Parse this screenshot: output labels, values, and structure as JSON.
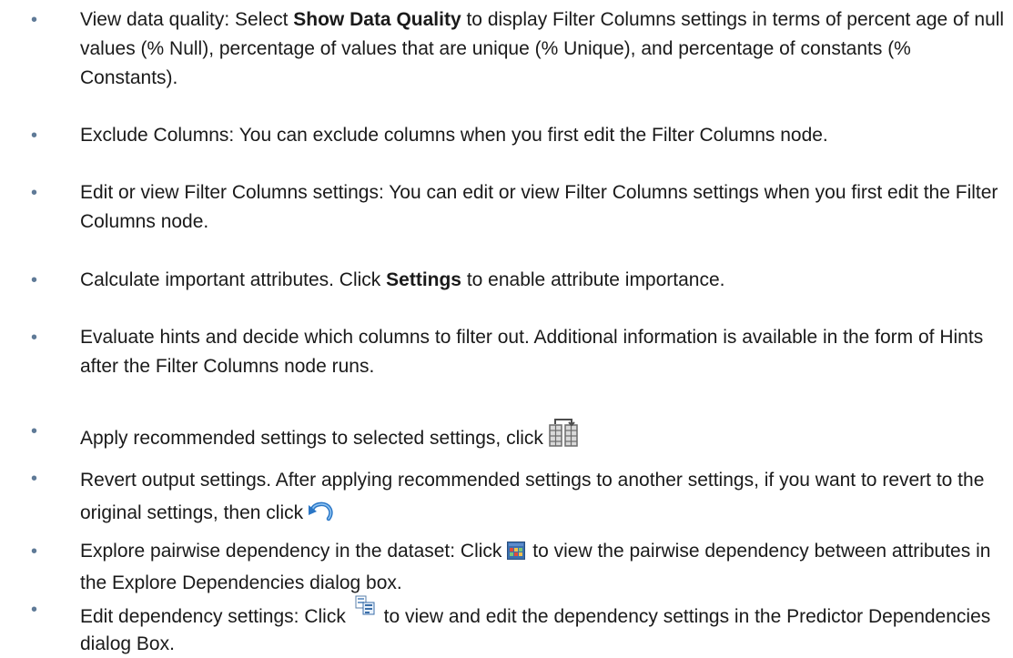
{
  "items": [
    {
      "pre": "View data quality: Select ",
      "bold": "Show Data Quality",
      "post": " to display Filter Columns settings in terms of percent age of null values (% Null), percentage of values that are unique (% Unique), and percentage of constants (% Constants)."
    },
    {
      "text": "Exclude Columns: You can exclude columns when you first edit the Filter Columns node."
    },
    {
      "text": "Edit or view Filter Columns settings: You can edit or view Filter Columns settings when you first edit the Filter Columns node."
    },
    {
      "pre": "Calculate important attributes. Click ",
      "bold": "Settings",
      "post": " to enable attribute importance."
    },
    {
      "text": "Evaluate hints and decide which columns to filter out. Additional information is available in the form of Hints after the Filter Columns node runs."
    },
    {
      "text": "Apply recommended settings to selected settings, click",
      "icon": "apply-recommended-settings-icon"
    },
    {
      "text": "Revert output settings. After applying recommended settings to another settings, if you want to revert to the original settings, then click",
      "icon": "revert-settings-icon"
    },
    {
      "pre": "Explore pairwise dependency in the dataset: Click",
      "icon": "explore-dependencies-icon",
      "post": " to view the pairwise dependency between attributes in the Explore Dependencies dialog box."
    },
    {
      "pre": "Edit dependency settings: Click",
      "icon": "edit-dependency-settings-icon",
      "post": " to view and edit the dependency settings in the Predictor Dependencies dialog Box."
    }
  ],
  "bullet_glyph": "•",
  "colors": {
    "bullet": "#5f7a97",
    "text": "#1a1a1a"
  }
}
